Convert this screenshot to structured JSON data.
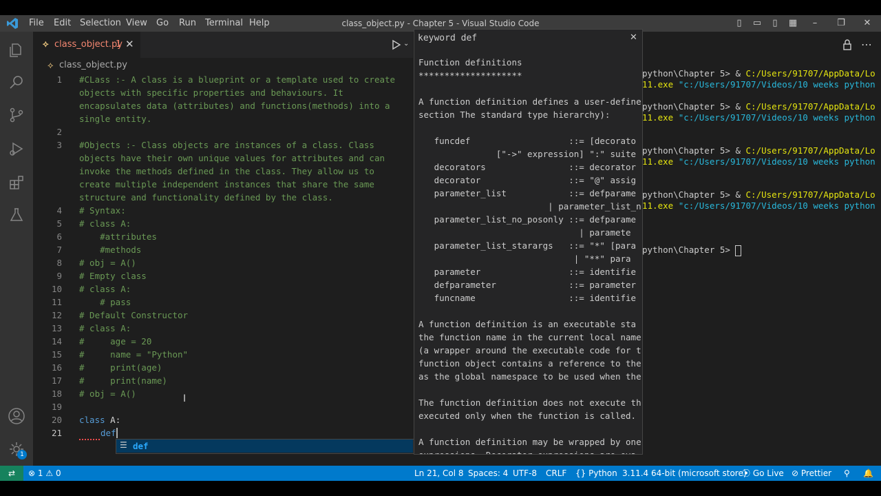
{
  "menu": [
    "File",
    "Edit",
    "Selection",
    "View",
    "Go",
    "Run",
    "Terminal",
    "Help"
  ],
  "window_title": "class_object.py - Chapter 5 - Visual Studio Code",
  "tab": {
    "label": "class_object.py",
    "badge": "1"
  },
  "breadcrumb": "class_object.py",
  "editor_lines": [
    {
      "n": "1",
      "t": "#CLass :- A class is a blueprint or a template used to create",
      "c": "cm"
    },
    {
      "n": "",
      "t": "objects with specific properties and behaviours. It",
      "c": "cm"
    },
    {
      "n": "",
      "t": "encapsulates data (attributes) and functions(methods) into a",
      "c": "cm"
    },
    {
      "n": "",
      "t": "single entity.",
      "c": "cm"
    },
    {
      "n": "2",
      "t": "",
      "c": "pl"
    },
    {
      "n": "3",
      "t": "#Objects :- Class objects are instances of a class. Class",
      "c": "cm"
    },
    {
      "n": "",
      "t": "objects have their own unique values for attributes and can",
      "c": "cm"
    },
    {
      "n": "",
      "t": "invoke the methods defined in the class. They allow us to",
      "c": "cm"
    },
    {
      "n": "",
      "t": "create multiple independent instances that share the same",
      "c": "cm"
    },
    {
      "n": "",
      "t": "structure and functionality defined by the class.",
      "c": "cm"
    },
    {
      "n": "4",
      "t": "# Syntax:",
      "c": "cm"
    },
    {
      "n": "5",
      "t": "# class A:",
      "c": "cm"
    },
    {
      "n": "6",
      "t": "    #attributes",
      "c": "cm"
    },
    {
      "n": "7",
      "t": "    #methods",
      "c": "cm"
    },
    {
      "n": "8",
      "t": "# obj = A()",
      "c": "cm"
    },
    {
      "n": "9",
      "t": "# Empty class",
      "c": "cm"
    },
    {
      "n": "10",
      "t": "# class A:",
      "c": "cm"
    },
    {
      "n": "11",
      "t": "    # pass",
      "c": "cm"
    },
    {
      "n": "12",
      "t": "# Default Constructor",
      "c": "cm"
    },
    {
      "n": "13",
      "t": "# class A:",
      "c": "cm"
    },
    {
      "n": "14",
      "t": "#     age = 20",
      "c": "cm"
    },
    {
      "n": "15",
      "t": "#     name = \"Python\"",
      "c": "cm"
    },
    {
      "n": "16",
      "t": "#     print(age)",
      "c": "cm"
    },
    {
      "n": "17",
      "t": "#     print(name)",
      "c": "cm"
    },
    {
      "n": "18",
      "t": "# obj = A()",
      "c": "cm"
    },
    {
      "n": "19",
      "t": "",
      "c": "pl"
    },
    {
      "n": "20",
      "t": "",
      "c": "pl"
    },
    {
      "n": "21",
      "t": "",
      "c": "pl"
    }
  ],
  "line20": {
    "kw": "class",
    "rest": " A:"
  },
  "line21": {
    "indent": "    ",
    "text": "def"
  },
  "suggestion": "def",
  "hover": {
    "title": "keyword def",
    "lines": [
      "Function definitions",
      "********************",
      "",
      "A function definition defines a user-define",
      "section The standard type hierarchy):",
      "",
      "   funcdef                   ::= [decorato",
      "               [\"->\" expression] \":\" suite",
      "   decorators                ::= decorator",
      "   decorator                 ::= \"@\" assig",
      "   parameter_list            ::= defparame",
      "                         | parameter_list_n",
      "   parameter_list_no_posonly ::= defparame",
      "                               | paramete",
      "   parameter_list_starargs   ::= \"*\" [para",
      "                              | \"**\" para",
      "   parameter                 ::= identifie",
      "   defparameter              ::= parameter",
      "   funcname                  ::= identifie",
      "",
      "A function definition is an executable sta",
      "the function name in the current local name",
      "(a wrapper around the executable code for t",
      "function object contains a reference to the",
      "as the global namespace to be used when the",
      "",
      "The function definition does not execute th",
      "executed only when the function is called.",
      "",
      "A function definition may be wrapped by one",
      "expressions. Decorator expressions are eva"
    ]
  },
  "terminal": [
    {
      "a": "python\\Chapter 5> & ",
      "b": "C:/Users/91707/AppData/Lo",
      "c": ""
    },
    {
      "a": "",
      "b": "11.exe ",
      "c": "\"c:/Users/91707/Videos/10 weeks python"
    },
    {
      "a": "",
      "b": "",
      "c": ""
    },
    {
      "a": "python\\Chapter 5> & ",
      "b": "C:/Users/91707/AppData/Lo",
      "c": ""
    },
    {
      "a": "",
      "b": "11.exe ",
      "c": "\"c:/Users/91707/Videos/10 weeks python"
    },
    {
      "a": "",
      "b": "",
      "c": ""
    },
    {
      "a": "",
      "b": "",
      "c": ""
    },
    {
      "a": "python\\Chapter 5> & ",
      "b": "C:/Users/91707/AppData/Lo",
      "c": ""
    },
    {
      "a": "",
      "b": "11.exe ",
      "c": "\"c:/Users/91707/Videos/10 weeks python"
    },
    {
      "a": "",
      "b": "",
      "c": ""
    },
    {
      "a": "",
      "b": "",
      "c": ""
    },
    {
      "a": "python\\Chapter 5> & ",
      "b": "C:/Users/91707/AppData/Lo",
      "c": ""
    },
    {
      "a": "",
      "b": "11.exe ",
      "c": "\"c:/Users/91707/Videos/10 weeks python"
    },
    {
      "a": "",
      "b": "",
      "c": ""
    },
    {
      "a": "",
      "b": "",
      "c": ""
    },
    {
      "a": "",
      "b": "",
      "c": ""
    },
    {
      "a": "python\\Chapter 5> ",
      "b": "",
      "c": ""
    }
  ],
  "status": {
    "errors": "1",
    "warnings": "0",
    "position": "Ln 21, Col 8",
    "spaces": "Spaces: 4",
    "encoding": "UTF-8",
    "eol": "CRLF",
    "language": "Python",
    "interpreter": "3.11.4 64-bit (microsoft store)",
    "golive": "Go Live",
    "prettier": "Prettier"
  },
  "settings_badge": "1",
  "colors": {
    "accent": "#007acc",
    "comment": "#6a9955",
    "keyword": "#569cd6",
    "terminal_yellow": "#e5e510",
    "terminal_cyan": "#29b8db"
  }
}
